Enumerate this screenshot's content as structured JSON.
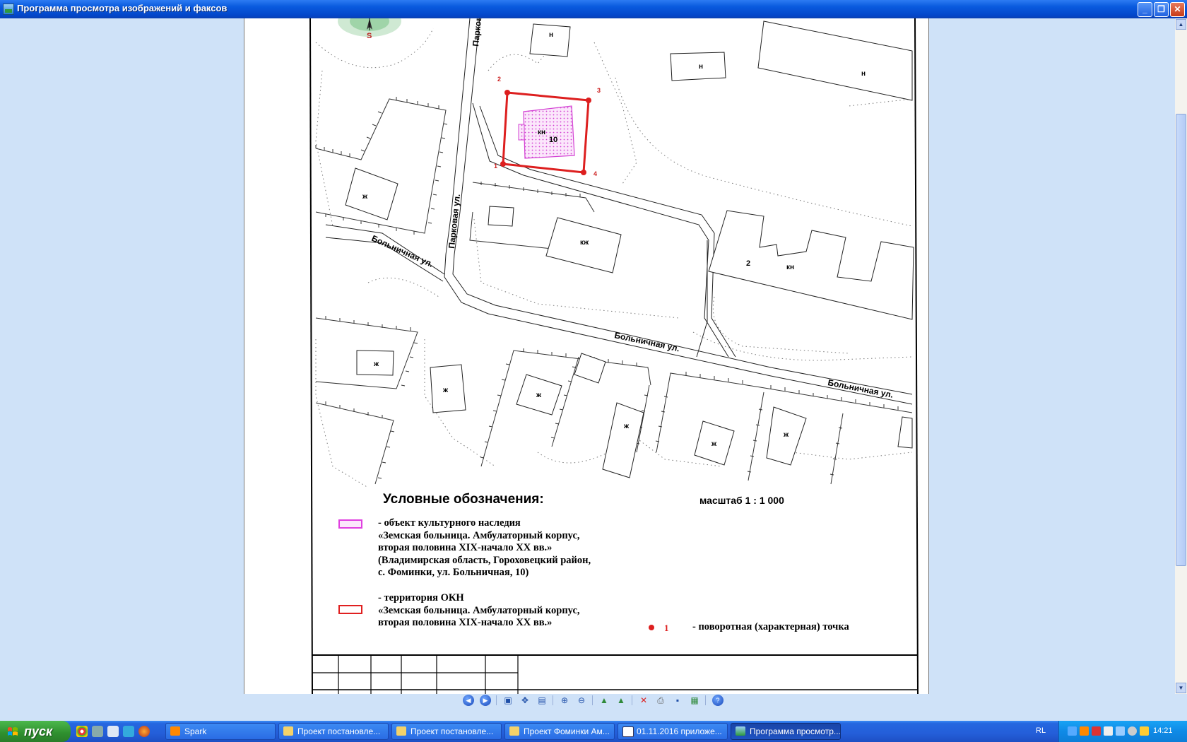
{
  "window": {
    "title": "Программа просмотра изображений и факсов",
    "buttons": {
      "minimize": "_",
      "maximize": "❐",
      "close": "✕"
    }
  },
  "map": {
    "north_letter": "S",
    "streets": [
      "Парков",
      "Парковая ул.",
      "Больничная ул.",
      "Больничная ул.",
      "Больничная ул."
    ],
    "building_labels": [
      "н",
      "н",
      "н",
      "кн",
      "10",
      "ж",
      "кж",
      "2",
      "кн",
      "ж",
      "ж",
      "ж",
      "ж",
      "ж",
      "ж"
    ],
    "point_labels": [
      "1",
      "2",
      "3",
      "4"
    ]
  },
  "legend": {
    "title": "Условные обозначения:",
    "scale": "масштаб 1 : 1 000",
    "items": [
      {
        "lines": [
          "- объект культурного наследия",
          "«Земская больница. Амбулаторный корпус,",
          "вторая половина XIX-начало XX вв.»",
          "(Владимирская область, Гороховецкий район,",
          "с. Фоминки, ул. Больничная, 10)"
        ],
        "swatch_color": "#e040e0"
      },
      {
        "lines": [
          "- территория ОКН",
          "«Земская больница. Амбулаторный корпус,",
          "вторая половина XIX-начало XX вв.»"
        ],
        "swatch_color": "#e02020"
      }
    ],
    "point": {
      "number": "1",
      "text": "- поворотная (характерная) точка",
      "color": "#e02020"
    }
  },
  "toolbar": {
    "icons": [
      "prev-image-icon",
      "next-image-icon",
      "best-fit-icon",
      "actual-size-icon",
      "slideshow-icon",
      "zoom-in-icon",
      "zoom-out-icon",
      "rotate-clockwise-icon",
      "rotate-counterclockwise-icon",
      "delete-icon",
      "print-icon",
      "save-icon",
      "open-editor-icon",
      "help-icon"
    ]
  },
  "taskbar": {
    "start_label": "пуск",
    "tasks": [
      {
        "label": "Spark",
        "icon": "flame-icon"
      },
      {
        "label": "Проект постановле...",
        "icon": "folder-icon"
      },
      {
        "label": "Проект постановле...",
        "icon": "folder-icon"
      },
      {
        "label": "Проект Фоминки Ам...",
        "icon": "folder-icon"
      },
      {
        "label": "01.11.2016 приложе...",
        "icon": "document-icon"
      },
      {
        "label": "Программа просмотр...",
        "icon": "image-viewer-icon",
        "active": true
      }
    ],
    "language": "RL",
    "clock": "14:21"
  }
}
